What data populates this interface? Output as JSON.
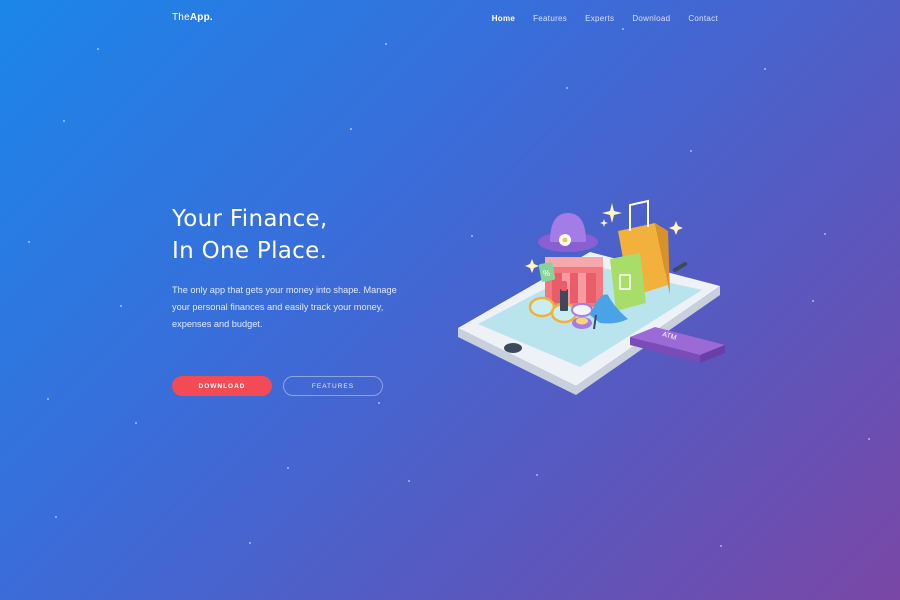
{
  "brand": {
    "light": "The",
    "bold": "App."
  },
  "nav": {
    "items": [
      {
        "label": "Home",
        "active": true
      },
      {
        "label": "Features",
        "active": false
      },
      {
        "label": "Experts",
        "active": false
      },
      {
        "label": "Download",
        "active": false
      },
      {
        "label": "Contact",
        "active": false
      }
    ]
  },
  "hero": {
    "title_line1": "Your Finance,",
    "title_line2": "In One Place.",
    "description": "The only app that gets your money into shape. Manage your personal finances and easily track your money, expenses and budget.",
    "primary_button": "DOWNLOAD",
    "secondary_button": "FEATURES"
  },
  "illustration": {
    "card_label": "ATM",
    "tag_label": "%"
  },
  "colors": {
    "gradient_start": "#1b86e9",
    "gradient_end": "#7a47a6",
    "accent": "#f24b55"
  }
}
